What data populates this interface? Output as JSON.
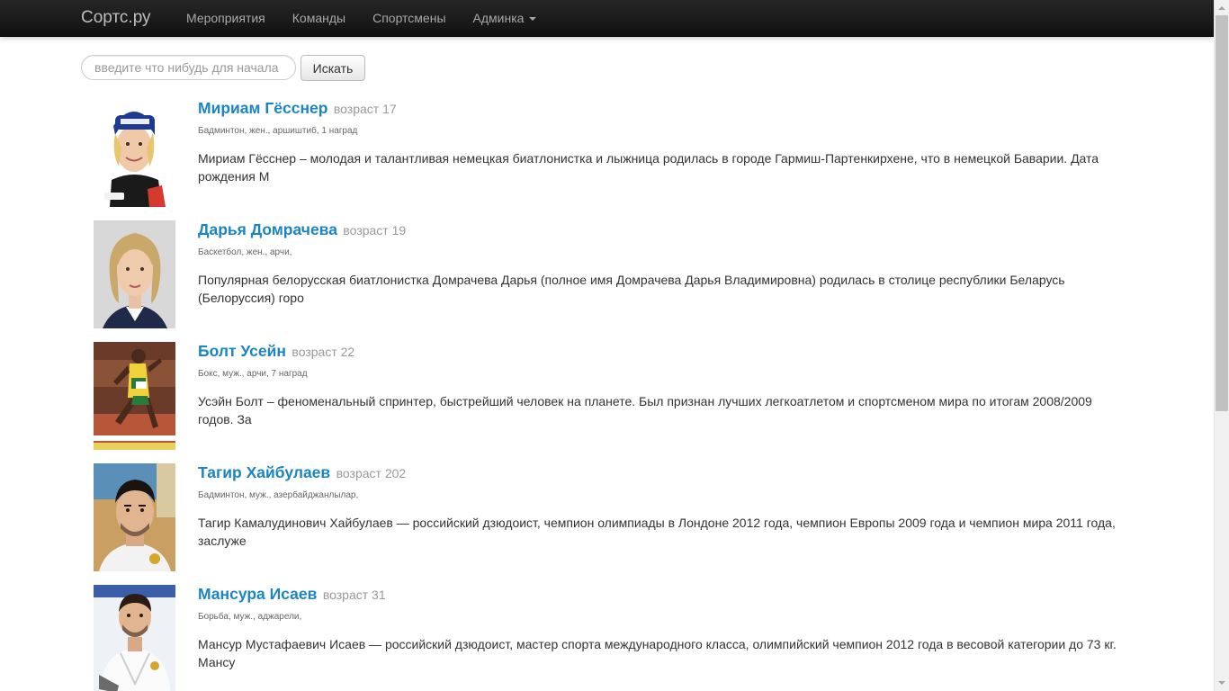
{
  "navbar": {
    "brand": "Сортс.ру",
    "items": [
      {
        "label": "Мероприятия"
      },
      {
        "label": "Команды"
      },
      {
        "label": "Спортсмены"
      },
      {
        "label": "Админка"
      }
    ]
  },
  "search": {
    "placeholder": "введите что нибудь для начала",
    "button_label": "Искать"
  },
  "athletes": [
    {
      "name": "Мириам Гёсснер",
      "age": "возраст 17",
      "meta": "Бадминтон, жен., аршиштиб, 1 наград",
      "description": "Мириам Гёсснер – молодая и талантливая немецкая биатлонистка и лыжница родилась в городе Гармиш-Партенкирхене, что в немецкой Баварии. Дата рождения М"
    },
    {
      "name": "Дарья Домрачева",
      "age": "возраст 19",
      "meta": "Баскетбол, жен., арчи,",
      "description": "Популярная белорусская биатлонистка Домрачева Дарья (полное имя Домрачева Дарья Владимировна) родилась в столице республики Беларусь (Белоруссия) горо"
    },
    {
      "name": "Болт Усейн",
      "age": "возраст 22",
      "meta": "Бокс, муж., арчи, 7 наград",
      "description": "Усэйн Болт – феноменальный спринтер, быстрейший человек на планете. Был признан лучших легкоатлетом и спортсменом мира по итогам 2008/2009 годов. За"
    },
    {
      "name": "Тагир Хайбулаев",
      "age": "возраст 202",
      "meta": "Бадминтон, муж., азербайджанлылар,",
      "description": "Тагир Камалудинович Хайбулаев — российский дзюдоист, чемпион олимпиады в Лондоне 2012 года, чемпион Европы 2009 года и чемпион мира 2011 года, заслуже"
    },
    {
      "name": "Мансура Исаев",
      "age": "возраст 31",
      "meta": "Борьба, муж., аджарели,",
      "description": "Мансур Мустафаевич Исаев — российский дзюдоист, мастер спорта международного класса, олимпийский чемпион 2012 года в весовой категории до 73 кг. Мансу"
    }
  ],
  "colors": {
    "link": "#1a85c2",
    "navbar": "#1b1b1b",
    "muted": "#999999"
  }
}
